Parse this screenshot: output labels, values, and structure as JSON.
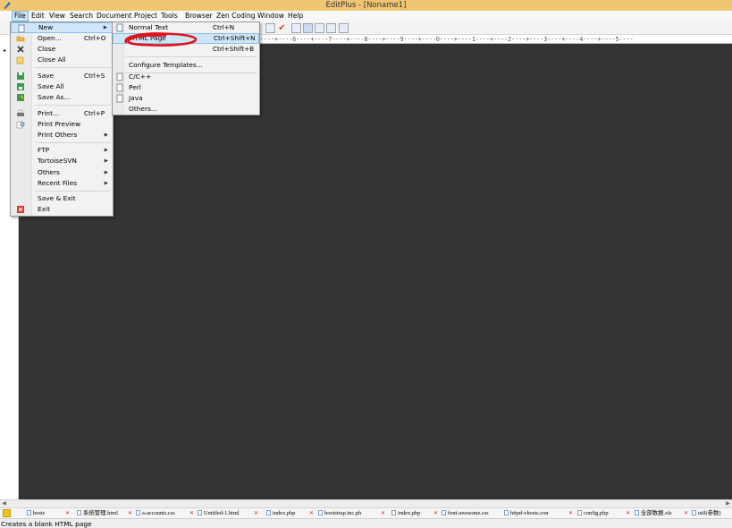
{
  "window": {
    "title": "EditPlus - [Noname1]"
  },
  "menubar": {
    "items": [
      "File",
      "Edit",
      "View",
      "Search",
      "Document",
      "Project",
      "Tools",
      "Browser",
      "Zen Coding",
      "Window",
      "Help"
    ]
  },
  "ruler": {
    "text": "----+----6----+----7----+----8----+----9----+----0----+----1----+----2----+----3----+----4----+----5----"
  },
  "file_menu": {
    "items": [
      {
        "label": "New",
        "shortcut": "",
        "submenu": true,
        "icon": "new-file-icon"
      },
      {
        "label": "Open...",
        "shortcut": "Ctrl+O",
        "submenu": false,
        "icon": "open-folder-icon"
      },
      {
        "label": "Close",
        "shortcut": "",
        "submenu": false,
        "icon": "close-x-icon"
      },
      {
        "label": "Close All",
        "shortcut": "",
        "submenu": false,
        "icon": "close-all-icon"
      },
      {
        "label": "Save",
        "shortcut": "Ctrl+S",
        "submenu": false,
        "icon": "save-icon"
      },
      {
        "label": "Save All",
        "shortcut": "",
        "submenu": false,
        "icon": "save-all-icon"
      },
      {
        "label": "Save As...",
        "shortcut": "",
        "submenu": false,
        "icon": "save-as-icon"
      },
      {
        "label": "Print...",
        "shortcut": "Ctrl+P",
        "submenu": false,
        "icon": "print-icon"
      },
      {
        "label": "Print Preview",
        "shortcut": "",
        "submenu": false,
        "icon": "print-preview-icon"
      },
      {
        "label": "Print Others",
        "shortcut": "",
        "submenu": true,
        "icon": ""
      },
      {
        "label": "FTP",
        "shortcut": "",
        "submenu": true,
        "icon": ""
      },
      {
        "label": "TortoiseSVN",
        "shortcut": "",
        "submenu": true,
        "icon": ""
      },
      {
        "label": "Others",
        "shortcut": "",
        "submenu": true,
        "icon": ""
      },
      {
        "label": "Recent Files",
        "shortcut": "",
        "submenu": true,
        "icon": ""
      },
      {
        "label": "Save & Exit",
        "shortcut": "",
        "submenu": false,
        "icon": ""
      },
      {
        "label": "Exit",
        "shortcut": "",
        "submenu": false,
        "icon": "exit-icon"
      }
    ]
  },
  "new_menu": {
    "items": [
      {
        "label": "Normal Text",
        "shortcut": "Ctrl+N",
        "icon": "text-doc-icon"
      },
      {
        "label": "HTML Page",
        "shortcut": "Ctrl+Shift+N",
        "icon": ""
      },
      {
        "label": "",
        "shortcut": "Ctrl+Shift+B",
        "icon": ""
      },
      {
        "label": "Configure Templates...",
        "shortcut": "",
        "icon": ""
      },
      {
        "label": "C/C++",
        "shortcut": "",
        "icon": "doc-icon"
      },
      {
        "label": "Perl",
        "shortcut": "",
        "icon": "doc-icon"
      },
      {
        "label": "Java",
        "shortcut": "",
        "icon": "doc-icon"
      },
      {
        "label": "Others...",
        "shortcut": "",
        "icon": ""
      }
    ]
  },
  "tabs": [
    {
      "label": "hosts"
    },
    {
      "label": "系统管理.html"
    },
    {
      "label": "a-accounts.css"
    },
    {
      "label": "Untitled-1.html"
    },
    {
      "label": "index.php"
    },
    {
      "label": "bootstrap.inc.ph"
    },
    {
      "label": "index.php"
    },
    {
      "label": "font-awesome.css"
    },
    {
      "label": "httpd-vhosts.con"
    },
    {
      "label": "config.php"
    },
    {
      "label": "全部数据.xls"
    },
    {
      "label": "util(参数)"
    }
  ],
  "status": {
    "text": "Creates a blank HTML page"
  },
  "colors": {
    "title_bar": "#f0c673",
    "editor_bg": "#333333",
    "highlight": "#cfe6f9",
    "annotation": "#e0121a"
  }
}
